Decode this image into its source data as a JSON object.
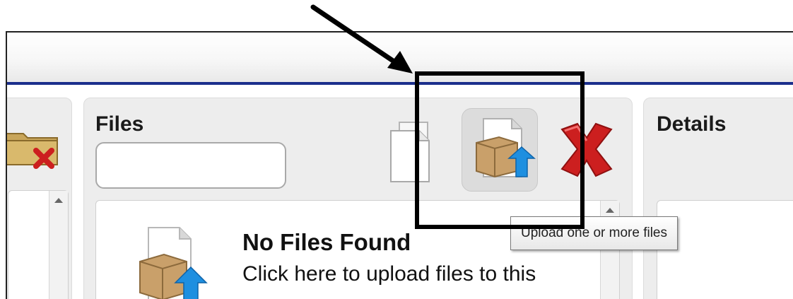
{
  "panels": {
    "files": {
      "title": "Files",
      "search": {
        "value": "",
        "placeholder": ""
      },
      "toolbar": [
        {
          "name": "copy-files",
          "icon": "copy-icon"
        },
        {
          "name": "upload-files",
          "icon": "upload-box-icon"
        },
        {
          "name": "delete-files",
          "icon": "delete-x-icon"
        }
      ],
      "empty_state": {
        "title": "No Files Found",
        "text": "Click here to upload files to this",
        "icon": "upload-box-icon"
      }
    },
    "details": {
      "title": "Details"
    },
    "folders": {
      "icon": "delete-folder-icon"
    }
  },
  "tooltip": {
    "text": "Upload one or more files"
  },
  "colors": {
    "accent_line": "#1b2e8c",
    "panel_bg": "#ededed",
    "delete_red": "#cc1f1f"
  }
}
